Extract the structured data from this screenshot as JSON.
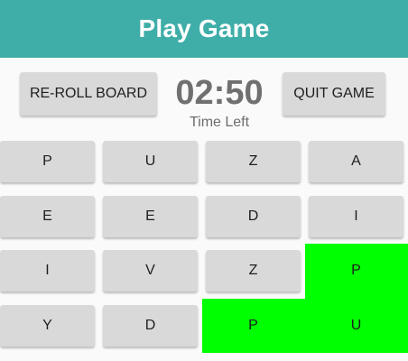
{
  "app": {
    "title": "Play Game"
  },
  "controls": {
    "reroll_label": "RE-ROLL BOARD",
    "quit_label": "QUIT GAME",
    "timer": "02:50",
    "timer_caption": "Time Left"
  },
  "board": {
    "rows": [
      [
        "P",
        "U",
        "Z",
        "A"
      ],
      [
        "E",
        "E",
        "D",
        "I"
      ],
      [
        "I",
        "V",
        "Z",
        "P"
      ],
      [
        "Y",
        "D",
        "P",
        "U"
      ]
    ],
    "selected": [
      [
        2,
        3
      ],
      [
        3,
        2
      ],
      [
        3,
        3
      ]
    ],
    "highlight_color": "#00ff00"
  },
  "colors": {
    "accent": "#3fada8",
    "tile": "#d9d9d9"
  }
}
